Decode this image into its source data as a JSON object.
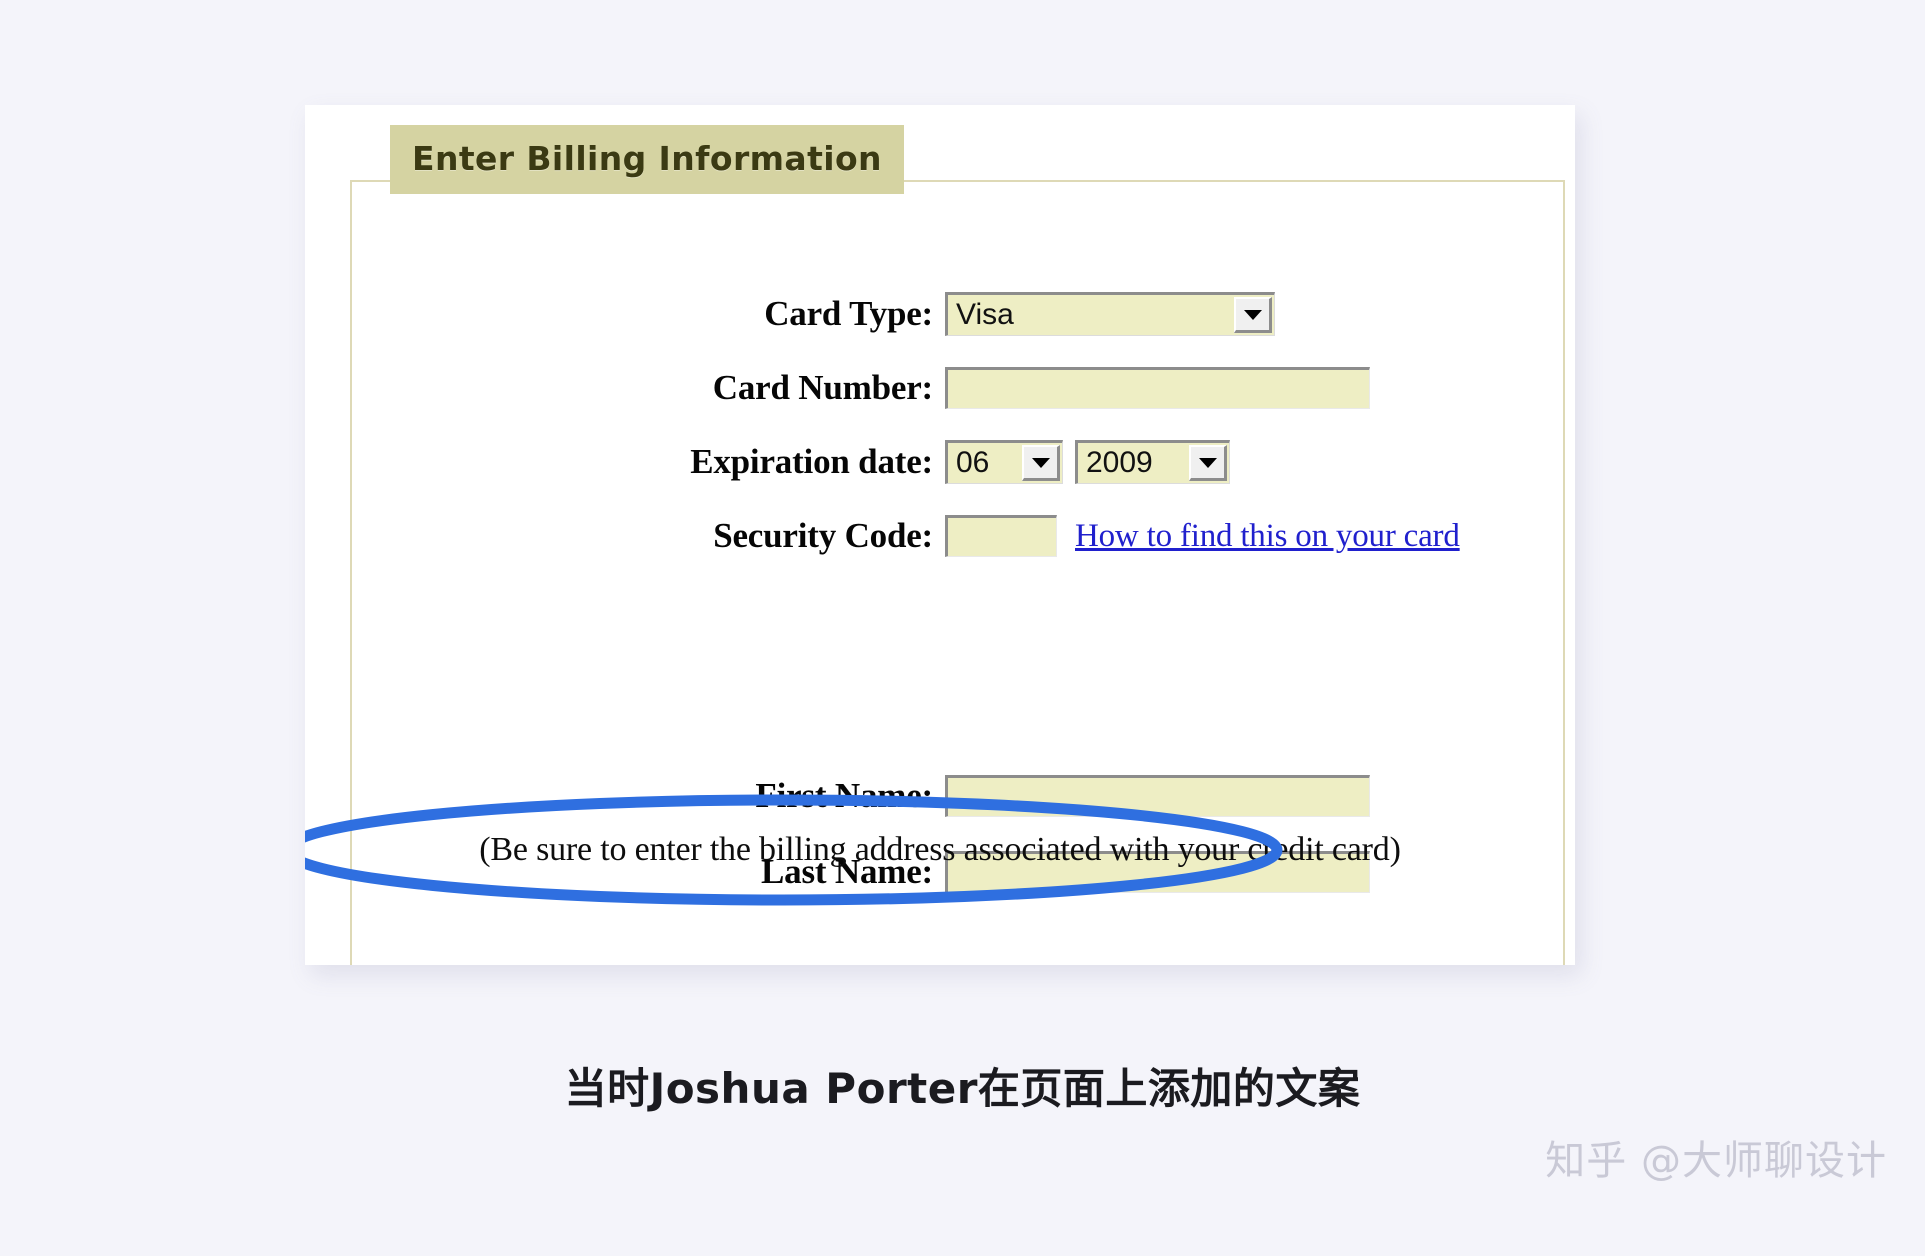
{
  "page": {
    "background_color": "#f4f4fa",
    "caption": "当时Joshua Porter在页面上添加的文案",
    "watermark": "知乎 @大师聊设计"
  },
  "form": {
    "legend": "Enter Billing Information",
    "legend_bg_color": "#d5d3a2",
    "border_color": "#ded9b6",
    "field_bg_color": "#eeeec4",
    "rows": [
      {
        "label": "Card Type:",
        "control": "select",
        "value": "Visa"
      },
      {
        "label": "Card Number:",
        "control": "text",
        "value": ""
      },
      {
        "label": "Expiration date:",
        "control": "select-pair",
        "month": "06",
        "year": "2009"
      },
      {
        "label": "Security Code:",
        "control": "text-with-link",
        "value": "",
        "link": "How to find this on your card",
        "link_color": "#2020cd"
      },
      {
        "label": "First Name:",
        "control": "text",
        "value": ""
      },
      {
        "label": "Last Name:",
        "control": "text",
        "value": ""
      }
    ]
  },
  "annotation": {
    "note": "(Be sure to enter the billing address associated with your credit card)",
    "ellipse_color": "#2f6fe0"
  }
}
